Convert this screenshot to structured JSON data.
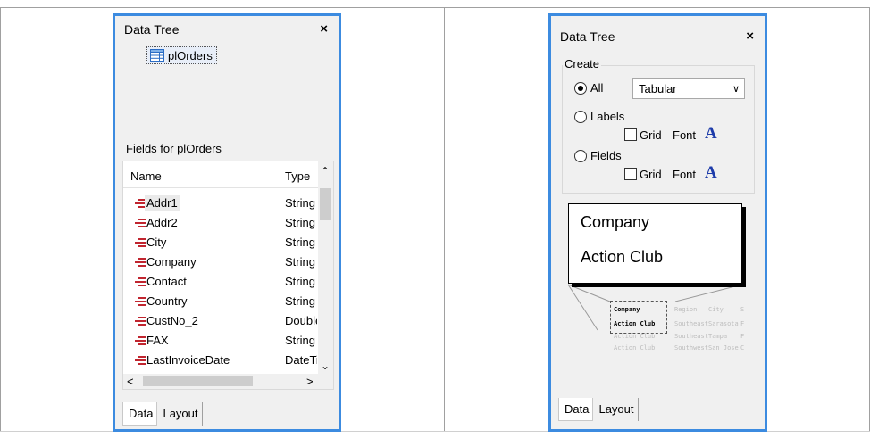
{
  "left_panel": {
    "title": "Data Tree",
    "close_glyph": "×",
    "tree_node": {
      "label": "plOrders",
      "icon": "table-icon"
    },
    "fields_title": "Fields for plOrders",
    "columns": {
      "name": "Name",
      "type": "Type"
    },
    "rows": [
      {
        "name": "Addr1",
        "type": "String"
      },
      {
        "name": "Addr2",
        "type": "String"
      },
      {
        "name": "City",
        "type": "String"
      },
      {
        "name": "Company",
        "type": "String"
      },
      {
        "name": "Contact",
        "type": "String"
      },
      {
        "name": "Country",
        "type": "String"
      },
      {
        "name": "CustNo_2",
        "type": "Double"
      },
      {
        "name": "FAX",
        "type": "String"
      },
      {
        "name": "LastInvoiceDate",
        "type": "DateTime"
      }
    ],
    "field_icon": "field-icon",
    "field_icon_color": "#c0252f",
    "tabs": [
      "Data",
      "Layout"
    ]
  },
  "right_panel": {
    "title": "Data Tree",
    "close_glyph": "×",
    "create": {
      "group_label": "Create",
      "all_label": "All",
      "all_selected": true,
      "layout_value": "Tabular",
      "labels_label": "Labels",
      "fields_label": "Fields",
      "grid_label": "Grid",
      "font_label": "Font",
      "font_glyph": "A"
    },
    "preview": {
      "heading": "Company",
      "value": "Action Club",
      "mini_headers": [
        "Company",
        "Region",
        "City",
        "S"
      ],
      "mini_row1": [
        "Action Club",
        "Southeast",
        "Sarasota",
        "F"
      ],
      "mini_row2": [
        "Action Club",
        "Southeast",
        "Tampa",
        "F"
      ],
      "mini_row3": [
        "Action Club",
        "Southwest",
        "San Jose",
        "C"
      ]
    },
    "tabs": [
      "Data",
      "Layout"
    ]
  },
  "colors": {
    "window_border": "#3c8be0",
    "font_icon": "#1e3caa"
  }
}
